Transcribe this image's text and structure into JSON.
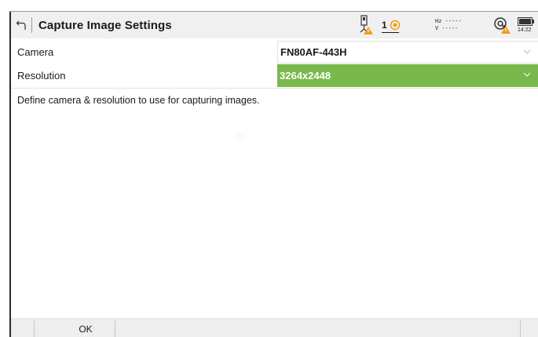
{
  "header": {
    "title": "Capture Image Settings",
    "back_icon": "back-arrow-icon",
    "prism_number": "1",
    "angle_hz": "Hz -----",
    "angle_v": "V  -----",
    "battery_time": "14:22",
    "warning_color": "#f39c12"
  },
  "settings": {
    "camera_label": "Camera",
    "camera_value": "FN80AF-443H",
    "resolution_label": "Resolution",
    "resolution_value": "3264x2448",
    "selected_color": "#79b94c"
  },
  "description": "Define camera & resolution to use for capturing images.",
  "footer": {
    "ok_label": "OK"
  }
}
